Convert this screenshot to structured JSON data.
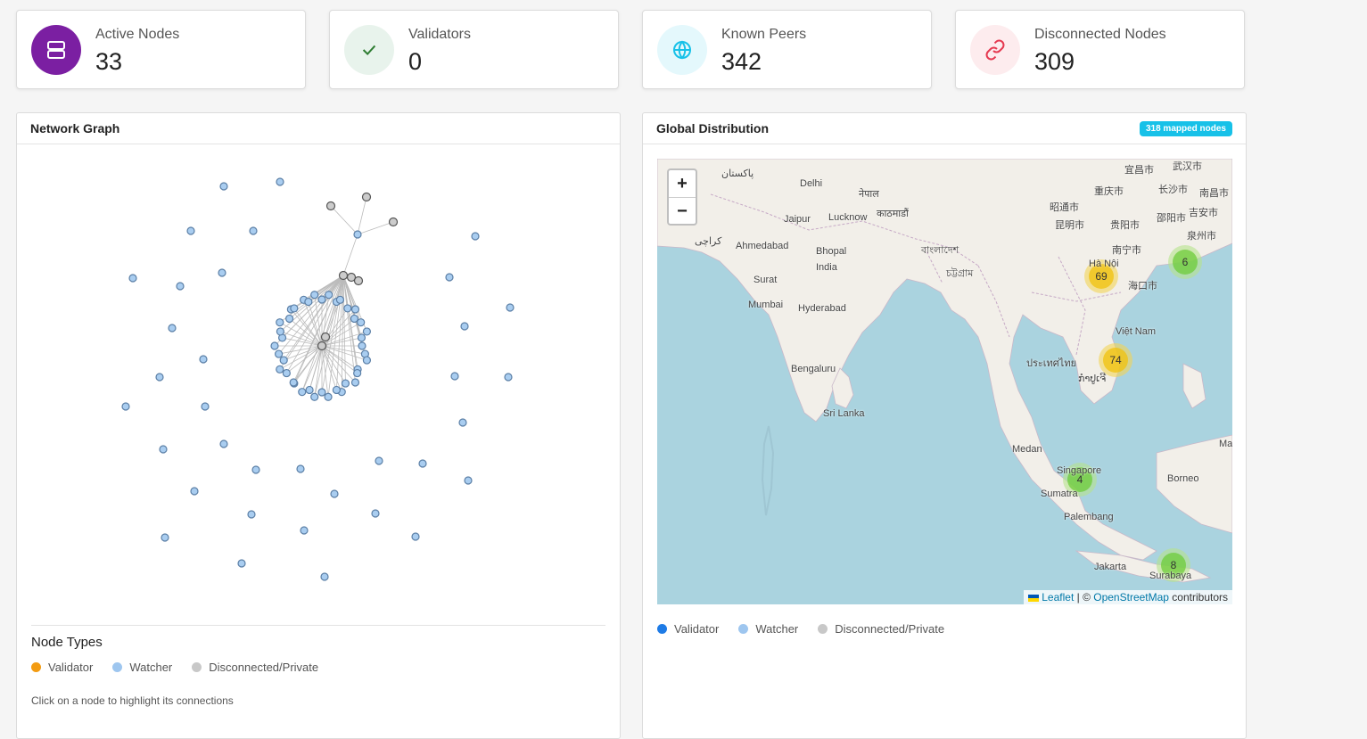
{
  "stats": [
    {
      "label": "Active Nodes",
      "value": "33",
      "icon": "server-icon",
      "color": "#7b1fa2",
      "bg": "#7b1fa2"
    },
    {
      "label": "Validators",
      "value": "0",
      "icon": "check-icon",
      "color": "#2e7d32",
      "bg": "#e8f3ec"
    },
    {
      "label": "Known Peers",
      "value": "342",
      "icon": "globe-icon",
      "color": "#17c1e8",
      "bg": "#e4f8fc"
    },
    {
      "label": "Disconnected Nodes",
      "value": "309",
      "icon": "link-icon",
      "color": "#e53950",
      "bg": "#fdecee"
    }
  ],
  "network_graph": {
    "title": "Network Graph",
    "legend_title": "Node Types",
    "legend": [
      {
        "label": "Validator",
        "color": "#f39c12"
      },
      {
        "label": "Watcher",
        "color": "#9ec6ef"
      },
      {
        "label": "Disconnected/Private",
        "color": "#c8c8c8"
      }
    ],
    "hint": "Click on a node to highlight its connections"
  },
  "global_distribution": {
    "title": "Global Distribution",
    "badge": "318 mapped nodes",
    "zoom_in": "+",
    "zoom_out": "−",
    "attribution_leaflet": "Leaflet",
    "attribution_sep": " | © ",
    "attribution_osm": "OpenStreetMap",
    "attribution_tail": " contributors",
    "legend": [
      {
        "label": "Validator",
        "color": "#1e7be6"
      },
      {
        "label": "Watcher",
        "color": "#9ec6ef"
      },
      {
        "label": "Disconnected/Private",
        "color": "#c8c8c8"
      }
    ],
    "map_labels": [
      "پاکستان",
      "Delhi",
      "नेपाल",
      "Jaipur",
      "Lucknow",
      "काठमाडौं",
      "کراچی",
      "Ahmedabad",
      "Bhopal",
      "India",
      "বাংলাদেশ",
      "চট্টগ্রাম",
      "Surat",
      "Mumbai",
      "Hyderabad",
      "Bengaluru",
      "Sri Lanka",
      "Medan",
      "Singapore",
      "Sumatra",
      "Palembang",
      "Jakarta",
      "Surabaya",
      "Borneo",
      "Việt Nam",
      "ประเทศไทย",
      "ກຳປູເຈີ",
      "Hà Nội",
      "重庆市",
      "长沙市",
      "昆明市",
      "贵阳市",
      "南宁市",
      "海口市",
      "吉安市",
      "泉州市",
      "宜昌市",
      "武汉市",
      "昭通市",
      "邵阳市",
      "南昌市",
      "Malay"
    ],
    "clusters": [
      {
        "count": "69",
        "color": "yellow"
      },
      {
        "count": "74",
        "color": "yellow"
      },
      {
        "count": "6",
        "color": "green"
      },
      {
        "count": "4",
        "color": "green"
      },
      {
        "count": "8",
        "color": "green"
      }
    ]
  }
}
